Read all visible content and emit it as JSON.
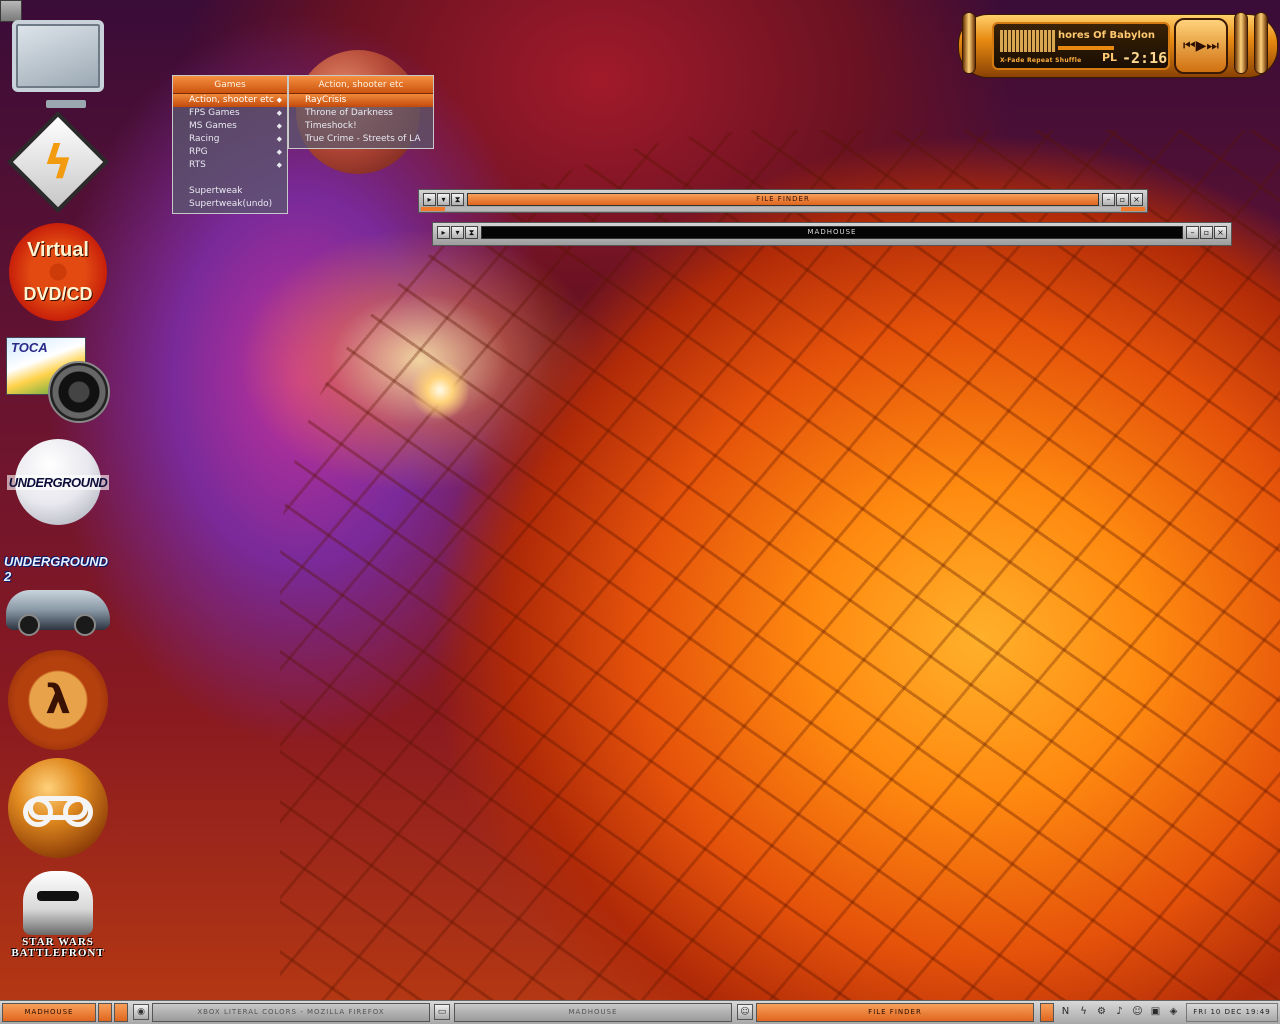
{
  "menus": {
    "games": {
      "title": "Games",
      "items": [
        {
          "label": "Action, shooter etc",
          "arrow": "◆"
        },
        {
          "label": "FPS Games",
          "arrow": "◆"
        },
        {
          "label": "MS Games",
          "arrow": "◆"
        },
        {
          "label": "Racing",
          "arrow": "◆"
        },
        {
          "label": "RPG",
          "arrow": "◆"
        },
        {
          "label": "RTS",
          "arrow": "◆"
        },
        {
          "label": "Supertweak",
          "arrow": ""
        },
        {
          "label": "Supertweak(undo)",
          "arrow": ""
        }
      ]
    },
    "action": {
      "title": "Action, shooter etc",
      "items": [
        "RayCrisis",
        "Throne of Darkness",
        "Timeshock!",
        "True Crime - Streets of LA"
      ]
    }
  },
  "windows": {
    "file_finder": {
      "title": "FILE FINDER"
    },
    "madhouse": {
      "title": "MADHOUSE"
    }
  },
  "winamp": {
    "title": "hores Of Babylon",
    "time": "-2:16",
    "pl": "PL",
    "options": "X-Fade Repeat Shuffle"
  },
  "desktop_icons": {
    "virtual_line1": "Virtual",
    "virtual_line2": "DVD/CD",
    "toca": "TOCA",
    "nfsu": "UNDERGROUND",
    "nfsu2": "UNDERGROUND 2",
    "hl2": "λ",
    "swbf": "STAR WARS BATTLEFRONT"
  },
  "taskbar": {
    "workspace": "MADHOUSE",
    "tasks": [
      {
        "label": "XBOX LITERAL COLORS - MOZILLA FIREFOX",
        "active": false
      },
      {
        "label": "MADHOUSE",
        "active": false
      },
      {
        "label": "FILE FINDER",
        "active": true
      }
    ],
    "clock": "FRI 10 DEC 19:49"
  },
  "colors": {
    "accent": "#e0661e",
    "menu_bg": "#5a5a6e"
  }
}
